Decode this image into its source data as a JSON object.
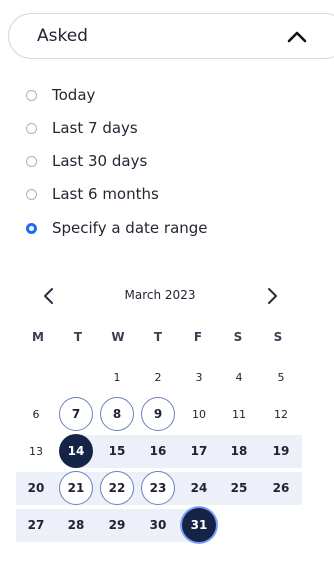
{
  "filter": {
    "label": "Asked",
    "options": [
      {
        "label": "Today",
        "selected": false
      },
      {
        "label": "Last 7 days",
        "selected": false
      },
      {
        "label": "Last 30 days",
        "selected": false
      },
      {
        "label": "Last 6 months",
        "selected": false
      },
      {
        "label": "Specify a date range",
        "selected": true
      }
    ]
  },
  "calendar": {
    "month_title": "March 2023",
    "weekdays": [
      "M",
      "T",
      "W",
      "T",
      "F",
      "S",
      "S"
    ],
    "weeks": [
      [
        "",
        "",
        "1",
        "2",
        "3",
        "4",
        "5"
      ],
      [
        "6",
        "7",
        "8",
        "9",
        "10",
        "11",
        "12"
      ],
      [
        "13",
        "14",
        "15",
        "16",
        "17",
        "18",
        "19"
      ],
      [
        "20",
        "21",
        "22",
        "23",
        "24",
        "25",
        "26"
      ],
      [
        "27",
        "28",
        "29",
        "30",
        "31",
        "",
        ""
      ]
    ],
    "range_start": "14",
    "range_end": "31",
    "outlined_days": [
      "7",
      "8",
      "9",
      "21",
      "22",
      "23"
    ],
    "accent_color": "#1a6ef5",
    "range_color": "#152346",
    "range_band_color": "#edf0f9"
  },
  "icons": {
    "collapse": "chevron-up-icon",
    "prev_month": "chevron-left-icon",
    "next_month": "chevron-right-icon"
  }
}
